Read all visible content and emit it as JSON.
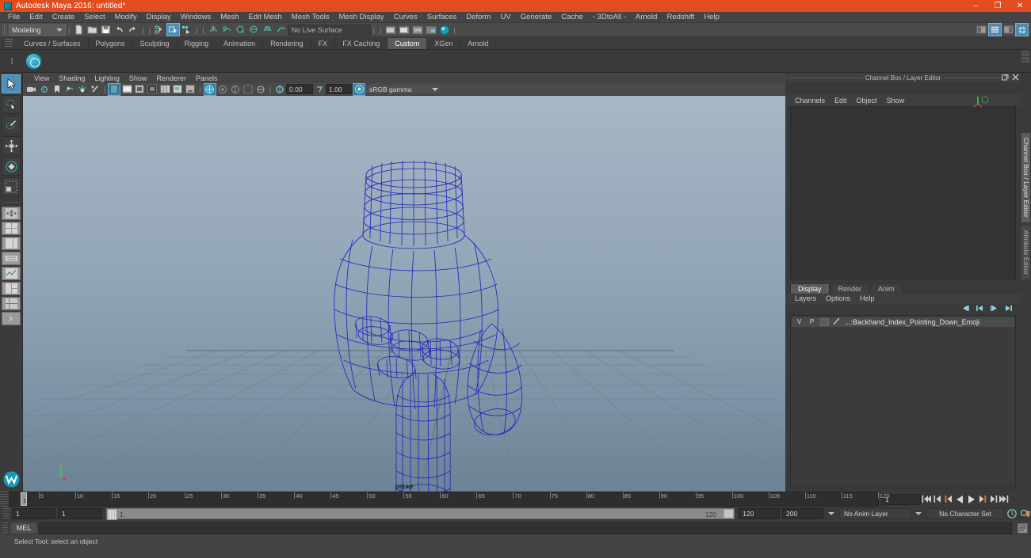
{
  "window": {
    "title": "Autodesk Maya 2016: untitled*",
    "app_icon": "maya-icon",
    "minimize": "–",
    "maximize": "❐",
    "close": "✕"
  },
  "menubar": {
    "items": [
      "File",
      "Edit",
      "Create",
      "Select",
      "Modify",
      "Display",
      "Windows",
      "Mesh",
      "Edit Mesh",
      "Mesh Tools",
      "Mesh Display",
      "Curves",
      "Surfaces",
      "Deform",
      "UV",
      "Generate",
      "Cache",
      "- 3DtoAll -",
      "Arnold",
      "Redshift",
      "Help"
    ]
  },
  "statusbar": {
    "menu_set": "Modeling",
    "live_surface": "No Live Surface",
    "icons": [
      "new-scene-icon",
      "open-scene-icon",
      "save-scene-icon",
      "undo-icon",
      "redo-icon",
      "select-by-hierarchy-icon",
      "select-by-object-icon",
      "select-by-component-icon",
      "snap-to-grid-icon",
      "snap-to-curve-icon",
      "snap-to-point-icon",
      "snap-to-projected-center-icon",
      "snap-to-view-plane-icon",
      "make-live-icon",
      "show-hide-editor-icon",
      "show-hide-attribute-editor-icon",
      "show-hide-tool-settings-icon",
      "show-hide-channel-box-icon",
      "render-view-icon",
      "ipr-render-icon",
      "render-settings-icon",
      "hypershade-icon"
    ]
  },
  "shelf": {
    "tabs": [
      "Curves / Surfaces",
      "Polygons",
      "Sculpting",
      "Rigging",
      "Animation",
      "Rendering",
      "FX",
      "FX Caching",
      "Custom",
      "XGen",
      "Arnold"
    ],
    "active_tab": "Custom",
    "button_icon": "polygon-sphere-icon"
  },
  "toolbox": {
    "tools": [
      {
        "name": "select-tool",
        "label": "Select Tool",
        "selected": true
      },
      {
        "name": "lasso-select-tool",
        "label": "Lasso Select Tool",
        "selected": false
      },
      {
        "name": "paint-select-tool",
        "label": "Paint Select Tool",
        "selected": false
      },
      {
        "name": "move-tool",
        "label": "Move Tool",
        "selected": false
      },
      {
        "name": "rotate-tool",
        "label": "Rotate Tool",
        "selected": false
      },
      {
        "name": "scale-tool",
        "label": "Scale Tool",
        "selected": false
      }
    ],
    "layout_buttons": [
      "single-perspective-layout",
      "four-view-layout",
      "two-pane-side-layout",
      "outliner-persp-layout",
      "persp-graph-layout",
      "hypershade-persp-layout",
      "outliner-only-layout"
    ],
    "bottom_icon": "maya-logo-icon"
  },
  "viewport_panel": {
    "menus": [
      "View",
      "Shading",
      "Lighting",
      "Show",
      "Renderer",
      "Panels"
    ],
    "toolbar_icons": [
      "select-camera-icon",
      "camera-attributes-icon",
      "bookmark-icon",
      "image-plane-icon",
      "two-sided-lighting-icon",
      "shadows-icon",
      "wireframe-icon",
      "smooth-shade-all-icon",
      "smooth-shade-selected-icon",
      "flat-shade-icon",
      "wireframe-on-shaded-icon",
      "textured-icon",
      "use-all-lights-icon",
      "shadow-icon",
      "ambient-occlusion-icon",
      "motion-blur-icon",
      "multisample-icon",
      "isolate-select-icon",
      "xray-icon",
      "xray-joints-icon"
    ],
    "exposure_value": "0.00",
    "gamma_value": "1.00",
    "color_space": "sRGB gamma",
    "camera_label": "persp"
  },
  "channel_box": {
    "panel_title": "Channel Box / Layer Editor",
    "menus": [
      "Channels",
      "Edit",
      "Object",
      "Show"
    ],
    "undock_icon": "undock-icon",
    "close_icon": "close-icon",
    "gizmo_icon": "axis-gizmo-icon"
  },
  "layer_editor": {
    "tabs": [
      "Display",
      "Render",
      "Anim"
    ],
    "active_tab": "Display",
    "menus": [
      "Layers",
      "Options",
      "Help"
    ],
    "tool_icons": [
      "move-layer-up-icon",
      "move-layer-down-icon",
      "new-layer-icon",
      "new-layer-from-selected-icon"
    ],
    "layers": [
      {
        "visibility": "V",
        "playback": "P",
        "shading": "",
        "type_icon": "layer-type-icon",
        "name": "...:Backhand_Index_Pointing_Down_Emoji"
      }
    ]
  },
  "right_vertical_tabs": [
    {
      "label": "Channel Box / Layer Editor",
      "active": true
    },
    {
      "label": "Attribute Editor",
      "active": false
    }
  ],
  "timeline": {
    "start": 1,
    "end": 120,
    "tick_step": 5,
    "current_frame": "1",
    "labels": [
      5,
      10,
      15,
      20,
      25,
      30,
      35,
      40,
      45,
      50,
      55,
      60,
      65,
      70,
      75,
      80,
      85,
      90,
      95,
      100,
      105,
      110,
      115,
      120
    ],
    "playback_buttons": [
      "go-to-start-icon",
      "step-back-frame-icon",
      "step-back-key-icon",
      "play-backwards-icon",
      "play-forwards-icon",
      "step-forward-key-icon",
      "step-forward-frame-icon",
      "go-to-end-icon"
    ]
  },
  "range_slider": {
    "anim_start": "1",
    "range_start": "1",
    "slider_start_label": "1",
    "slider_end_label": "120",
    "range_end": "120",
    "anim_end": "200",
    "anim_layer": "No Anim Layer",
    "character_set": "No Character Set",
    "auto_key_icon": "auto-keyframe-icon",
    "anim_prefs_icon": "animation-preferences-icon"
  },
  "command_line": {
    "language": "MEL",
    "input_value": "",
    "script_editor_icon": "script-editor-icon"
  },
  "help_line": {
    "text": "Select Tool: select an object"
  },
  "colors": {
    "title_bar": "#e14d1e",
    "accent_blue": "#4d8fb8",
    "panel_bg": "#3a3a3a",
    "wireframe": "#2626c8",
    "viewport_sky": "#9fb1c0"
  }
}
